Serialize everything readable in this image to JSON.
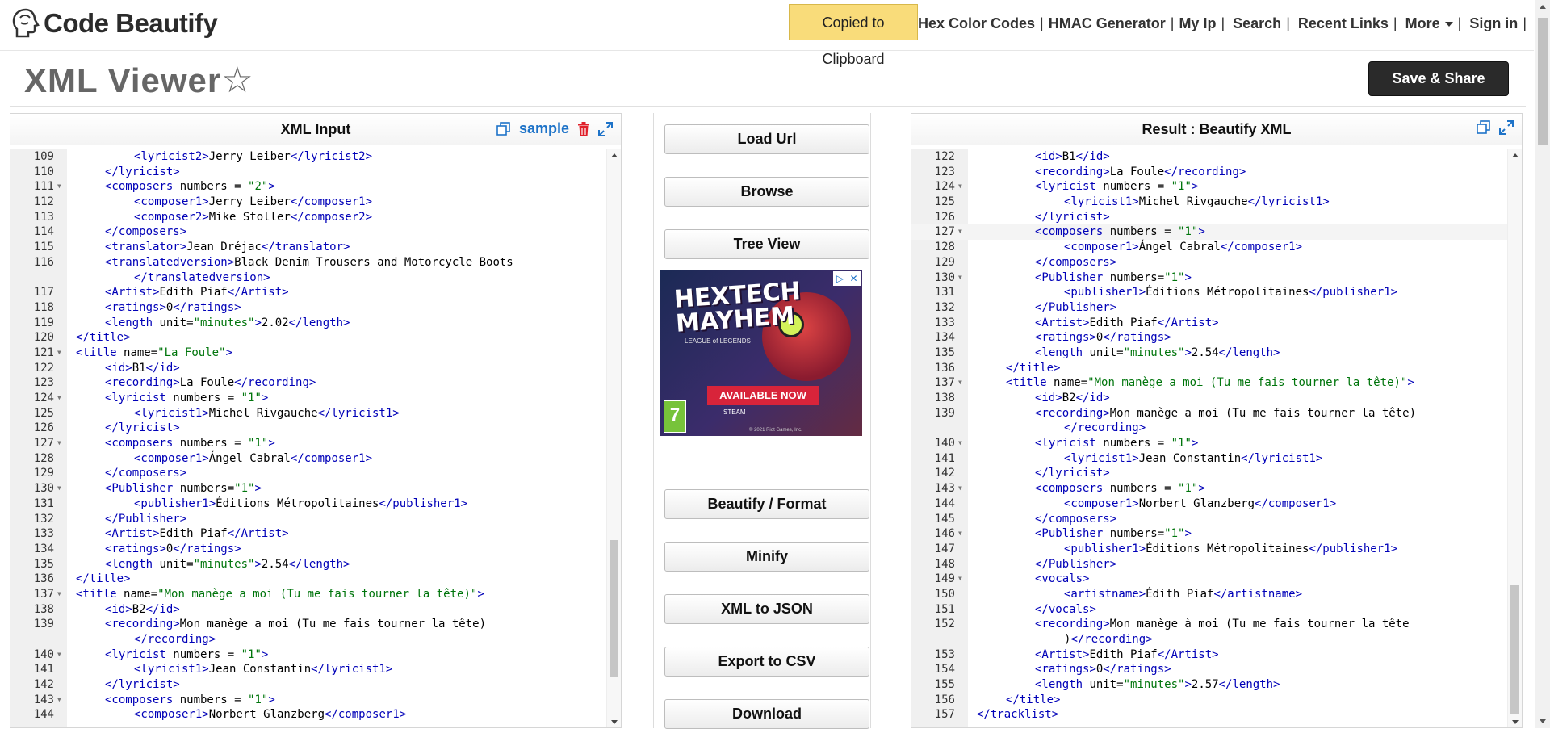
{
  "header": {
    "logo_text": "Code Beautify",
    "toast": "Copied to Clipboard",
    "nav": [
      "Hex Color Codes",
      "HMAC Generator",
      "My Ip",
      "Search",
      "Recent Links",
      "More",
      "Sign in"
    ],
    "separator": "|"
  },
  "page": {
    "title": "XML Viewer",
    "star": "☆",
    "save_share": "Save & Share"
  },
  "left_panel": {
    "title": "XML Input",
    "sample_link": "sample"
  },
  "right_panel": {
    "title": "Result : Beautify XML"
  },
  "middle_buttons": {
    "load_url": "Load Url",
    "browse": "Browse",
    "tree_view": "Tree View",
    "beautify": "Beautify / Format",
    "minify": "Minify",
    "xml_to_json": "XML to JSON",
    "export_csv": "Export to CSV",
    "download": "Download"
  },
  "ad": {
    "headline": "HEXTECH MAYHEM",
    "subline": "LEAGUE of LEGENDS",
    "cta": "AVAILABLE NOW",
    "rating": "7",
    "platforms": "STEAM",
    "copyright": "© 2021 Riot Games, Inc."
  },
  "left_lines": [
    {
      "n": "109",
      "f": false,
      "i": 2,
      "t": [
        [
          "tag",
          "<lyricist2>"
        ],
        [
          "txt",
          "Jerry Leiber"
        ],
        [
          "tag",
          "</lyricist2>"
        ]
      ]
    },
    {
      "n": "110",
      "f": false,
      "i": 1,
      "t": [
        [
          "tag",
          "</lyricist>"
        ]
      ]
    },
    {
      "n": "111",
      "f": true,
      "i": 1,
      "t": [
        [
          "tag",
          "<composers "
        ],
        [
          "txt",
          "numbers = "
        ],
        [
          "val",
          "\"2\""
        ],
        [
          "tag",
          ">"
        ]
      ]
    },
    {
      "n": "112",
      "f": false,
      "i": 2,
      "t": [
        [
          "tag",
          "<composer1>"
        ],
        [
          "txt",
          "Jerry Leiber"
        ],
        [
          "tag",
          "</composer1>"
        ]
      ]
    },
    {
      "n": "113",
      "f": false,
      "i": 2,
      "t": [
        [
          "tag",
          "<composer2>"
        ],
        [
          "txt",
          "Mike Stoller"
        ],
        [
          "tag",
          "</composer2>"
        ]
      ]
    },
    {
      "n": "114",
      "f": false,
      "i": 1,
      "t": [
        [
          "tag",
          "</composers>"
        ]
      ]
    },
    {
      "n": "115",
      "f": false,
      "i": 1,
      "t": [
        [
          "tag",
          "<translator>"
        ],
        [
          "txt",
          "Jean Dréjac"
        ],
        [
          "tag",
          "</translator>"
        ]
      ]
    },
    {
      "n": "116",
      "f": false,
      "i": 1,
      "t": [
        [
          "tag",
          "<translatedversion>"
        ],
        [
          "txt",
          "Black Denim Trousers and Motorcycle Boots"
        ]
      ]
    },
    {
      "n": "",
      "f": false,
      "i": 2,
      "t": [
        [
          "tag",
          "</translatedversion>"
        ]
      ]
    },
    {
      "n": "117",
      "f": false,
      "i": 1,
      "t": [
        [
          "tag",
          "<Artist>"
        ],
        [
          "txt",
          "Edith Piaf"
        ],
        [
          "tag",
          "</Artist>"
        ]
      ]
    },
    {
      "n": "118",
      "f": false,
      "i": 1,
      "t": [
        [
          "tag",
          "<ratings>"
        ],
        [
          "txt",
          "0"
        ],
        [
          "tag",
          "</ratings>"
        ]
      ]
    },
    {
      "n": "119",
      "f": false,
      "i": 1,
      "t": [
        [
          "tag",
          "<length "
        ],
        [
          "txt",
          "unit="
        ],
        [
          "val",
          "\"minutes\""
        ],
        [
          "tag",
          ">"
        ],
        [
          "txt",
          "2.02"
        ],
        [
          "tag",
          "</length>"
        ]
      ]
    },
    {
      "n": "120",
      "f": false,
      "i": 0,
      "t": [
        [
          "tag",
          "</title>"
        ]
      ]
    },
    {
      "n": "121",
      "f": true,
      "i": 0,
      "t": [
        [
          "tag",
          "<title "
        ],
        [
          "txt",
          "name="
        ],
        [
          "val",
          "\"La Foule\""
        ],
        [
          "tag",
          ">"
        ]
      ]
    },
    {
      "n": "122",
      "f": false,
      "i": 1,
      "t": [
        [
          "tag",
          "<id>"
        ],
        [
          "txt",
          "B1"
        ],
        [
          "tag",
          "</id>"
        ]
      ]
    },
    {
      "n": "123",
      "f": false,
      "i": 1,
      "t": [
        [
          "tag",
          "<recording>"
        ],
        [
          "txt",
          "La Foule"
        ],
        [
          "tag",
          "</recording>"
        ]
      ]
    },
    {
      "n": "124",
      "f": true,
      "i": 1,
      "t": [
        [
          "tag",
          "<lyricist "
        ],
        [
          "txt",
          "numbers = "
        ],
        [
          "val",
          "\"1\""
        ],
        [
          "tag",
          ">"
        ]
      ]
    },
    {
      "n": "125",
      "f": false,
      "i": 2,
      "t": [
        [
          "tag",
          "<lyricist1>"
        ],
        [
          "txt",
          "Michel Rivgauche"
        ],
        [
          "tag",
          "</lyricist1>"
        ]
      ]
    },
    {
      "n": "126",
      "f": false,
      "i": 1,
      "t": [
        [
          "tag",
          "</lyricist>"
        ]
      ]
    },
    {
      "n": "127",
      "f": true,
      "i": 1,
      "t": [
        [
          "tag",
          "<composers "
        ],
        [
          "txt",
          "numbers = "
        ],
        [
          "val",
          "\"1\""
        ],
        [
          "tag",
          ">"
        ]
      ]
    },
    {
      "n": "128",
      "f": false,
      "i": 2,
      "t": [
        [
          "tag",
          "<composer1>"
        ],
        [
          "txt",
          "Ángel Cabral"
        ],
        [
          "tag",
          "</composer1>"
        ]
      ]
    },
    {
      "n": "129",
      "f": false,
      "i": 1,
      "t": [
        [
          "tag",
          "</composers>"
        ]
      ]
    },
    {
      "n": "130",
      "f": true,
      "i": 1,
      "t": [
        [
          "tag",
          "<Publisher "
        ],
        [
          "txt",
          "numbers="
        ],
        [
          "val",
          "\"1\""
        ],
        [
          "tag",
          ">"
        ]
      ]
    },
    {
      "n": "131",
      "f": false,
      "i": 2,
      "t": [
        [
          "tag",
          "<publisher1>"
        ],
        [
          "txt",
          "Éditions Métropolitaines"
        ],
        [
          "tag",
          "</publisher1>"
        ]
      ]
    },
    {
      "n": "132",
      "f": false,
      "i": 1,
      "t": [
        [
          "tag",
          "</Publisher>"
        ]
      ]
    },
    {
      "n": "133",
      "f": false,
      "i": 1,
      "t": [
        [
          "tag",
          "<Artist>"
        ],
        [
          "txt",
          "Edith Piaf"
        ],
        [
          "tag",
          "</Artist>"
        ]
      ]
    },
    {
      "n": "134",
      "f": false,
      "i": 1,
      "t": [
        [
          "tag",
          "<ratings>"
        ],
        [
          "txt",
          "0"
        ],
        [
          "tag",
          "</ratings>"
        ]
      ]
    },
    {
      "n": "135",
      "f": false,
      "i": 1,
      "t": [
        [
          "tag",
          "<length "
        ],
        [
          "txt",
          "unit="
        ],
        [
          "val",
          "\"minutes\""
        ],
        [
          "tag",
          ">"
        ],
        [
          "txt",
          "2.54"
        ],
        [
          "tag",
          "</length>"
        ]
      ]
    },
    {
      "n": "136",
      "f": false,
      "i": 0,
      "t": [
        [
          "tag",
          "</title>"
        ]
      ]
    },
    {
      "n": "137",
      "f": true,
      "i": 0,
      "t": [
        [
          "tag",
          "<title "
        ],
        [
          "txt",
          "name="
        ],
        [
          "val",
          "\"Mon manège a moi (Tu me fais tourner la tête)\""
        ],
        [
          "tag",
          ">"
        ]
      ]
    },
    {
      "n": "138",
      "f": false,
      "i": 1,
      "t": [
        [
          "tag",
          "<id>"
        ],
        [
          "txt",
          "B2"
        ],
        [
          "tag",
          "</id>"
        ]
      ]
    },
    {
      "n": "139",
      "f": false,
      "i": 1,
      "t": [
        [
          "tag",
          "<recording>"
        ],
        [
          "txt",
          "Mon manège a moi (Tu me fais tourner la tête)"
        ]
      ]
    },
    {
      "n": "",
      "f": false,
      "i": 2,
      "t": [
        [
          "tag",
          "</recording>"
        ]
      ]
    },
    {
      "n": "140",
      "f": true,
      "i": 1,
      "t": [
        [
          "tag",
          "<lyricist "
        ],
        [
          "txt",
          "numbers = "
        ],
        [
          "val",
          "\"1\""
        ],
        [
          "tag",
          ">"
        ]
      ]
    },
    {
      "n": "141",
      "f": false,
      "i": 2,
      "t": [
        [
          "tag",
          "<lyricist1>"
        ],
        [
          "txt",
          "Jean Constantin"
        ],
        [
          "tag",
          "</lyricist1>"
        ]
      ]
    },
    {
      "n": "142",
      "f": false,
      "i": 1,
      "t": [
        [
          "tag",
          "</lyricist>"
        ]
      ]
    },
    {
      "n": "143",
      "f": true,
      "i": 1,
      "t": [
        [
          "tag",
          "<composers "
        ],
        [
          "txt",
          "numbers = "
        ],
        [
          "val",
          "\"1\""
        ],
        [
          "tag",
          ">"
        ]
      ]
    },
    {
      "n": "144",
      "f": false,
      "i": 2,
      "t": [
        [
          "tag",
          "<composer1>"
        ],
        [
          "txt",
          "Norbert Glanzberg"
        ],
        [
          "tag",
          "</composer1>"
        ]
      ]
    }
  ],
  "right_lines": [
    {
      "n": "122",
      "f": false,
      "i": 2,
      "t": [
        [
          "tag",
          "<id>"
        ],
        [
          "txt",
          "B1"
        ],
        [
          "tag",
          "</id>"
        ]
      ]
    },
    {
      "n": "123",
      "f": false,
      "i": 2,
      "t": [
        [
          "tag",
          "<recording>"
        ],
        [
          "txt",
          "La Foule"
        ],
        [
          "tag",
          "</recording>"
        ]
      ]
    },
    {
      "n": "124",
      "f": true,
      "i": 2,
      "t": [
        [
          "tag",
          "<lyricist "
        ],
        [
          "txt",
          "numbers = "
        ],
        [
          "val",
          "\"1\""
        ],
        [
          "tag",
          ">"
        ]
      ]
    },
    {
      "n": "125",
      "f": false,
      "i": 3,
      "t": [
        [
          "tag",
          "<lyricist1>"
        ],
        [
          "txt",
          "Michel Rivgauche"
        ],
        [
          "tag",
          "</lyricist1>"
        ]
      ]
    },
    {
      "n": "126",
      "f": false,
      "i": 2,
      "t": [
        [
          "tag",
          "</lyricist>"
        ]
      ]
    },
    {
      "n": "127",
      "f": true,
      "i": 2,
      "a": true,
      "t": [
        [
          "tag",
          "<composers "
        ],
        [
          "txt",
          "numbers = "
        ],
        [
          "val",
          "\"1\""
        ],
        [
          "tag",
          ">"
        ]
      ]
    },
    {
      "n": "128",
      "f": false,
      "i": 3,
      "t": [
        [
          "tag",
          "<composer1>"
        ],
        [
          "txt",
          "Ángel Cabral"
        ],
        [
          "tag",
          "</composer1>"
        ]
      ]
    },
    {
      "n": "129",
      "f": false,
      "i": 2,
      "t": [
        [
          "tag",
          "</composers>"
        ]
      ]
    },
    {
      "n": "130",
      "f": true,
      "i": 2,
      "t": [
        [
          "tag",
          "<Publisher "
        ],
        [
          "txt",
          "numbers="
        ],
        [
          "val",
          "\"1\""
        ],
        [
          "tag",
          ">"
        ]
      ]
    },
    {
      "n": "131",
      "f": false,
      "i": 3,
      "t": [
        [
          "tag",
          "<publisher1>"
        ],
        [
          "txt",
          "Éditions Métropolitaines"
        ],
        [
          "tag",
          "</publisher1>"
        ]
      ]
    },
    {
      "n": "132",
      "f": false,
      "i": 2,
      "t": [
        [
          "tag",
          "</Publisher>"
        ]
      ]
    },
    {
      "n": "133",
      "f": false,
      "i": 2,
      "t": [
        [
          "tag",
          "<Artist>"
        ],
        [
          "txt",
          "Edith Piaf"
        ],
        [
          "tag",
          "</Artist>"
        ]
      ]
    },
    {
      "n": "134",
      "f": false,
      "i": 2,
      "t": [
        [
          "tag",
          "<ratings>"
        ],
        [
          "txt",
          "0"
        ],
        [
          "tag",
          "</ratings>"
        ]
      ]
    },
    {
      "n": "135",
      "f": false,
      "i": 2,
      "t": [
        [
          "tag",
          "<length "
        ],
        [
          "txt",
          "unit="
        ],
        [
          "val",
          "\"minutes\""
        ],
        [
          "tag",
          ">"
        ],
        [
          "txt",
          "2.54"
        ],
        [
          "tag",
          "</length>"
        ]
      ]
    },
    {
      "n": "136",
      "f": false,
      "i": 1,
      "t": [
        [
          "tag",
          "</title>"
        ]
      ]
    },
    {
      "n": "137",
      "f": true,
      "i": 1,
      "t": [
        [
          "tag",
          "<title "
        ],
        [
          "txt",
          "name="
        ],
        [
          "val",
          "\"Mon manège a moi (Tu me fais tourner la tête)\""
        ],
        [
          "tag",
          ">"
        ]
      ]
    },
    {
      "n": "138",
      "f": false,
      "i": 2,
      "t": [
        [
          "tag",
          "<id>"
        ],
        [
          "txt",
          "B2"
        ],
        [
          "tag",
          "</id>"
        ]
      ]
    },
    {
      "n": "139",
      "f": false,
      "i": 2,
      "t": [
        [
          "tag",
          "<recording>"
        ],
        [
          "txt",
          "Mon manège a moi (Tu me fais tourner la tête)"
        ]
      ]
    },
    {
      "n": "",
      "f": false,
      "i": 3,
      "t": [
        [
          "tag",
          "</recording>"
        ]
      ]
    },
    {
      "n": "140",
      "f": true,
      "i": 2,
      "t": [
        [
          "tag",
          "<lyricist "
        ],
        [
          "txt",
          "numbers = "
        ],
        [
          "val",
          "\"1\""
        ],
        [
          "tag",
          ">"
        ]
      ]
    },
    {
      "n": "141",
      "f": false,
      "i": 3,
      "t": [
        [
          "tag",
          "<lyricist1>"
        ],
        [
          "txt",
          "Jean Constantin"
        ],
        [
          "tag",
          "</lyricist1>"
        ]
      ]
    },
    {
      "n": "142",
      "f": false,
      "i": 2,
      "t": [
        [
          "tag",
          "</lyricist>"
        ]
      ]
    },
    {
      "n": "143",
      "f": true,
      "i": 2,
      "t": [
        [
          "tag",
          "<composers "
        ],
        [
          "txt",
          "numbers = "
        ],
        [
          "val",
          "\"1\""
        ],
        [
          "tag",
          ">"
        ]
      ]
    },
    {
      "n": "144",
      "f": false,
      "i": 3,
      "t": [
        [
          "tag",
          "<composer1>"
        ],
        [
          "txt",
          "Norbert Glanzberg"
        ],
        [
          "tag",
          "</composer1>"
        ]
      ]
    },
    {
      "n": "145",
      "f": false,
      "i": 2,
      "t": [
        [
          "tag",
          "</composers>"
        ]
      ]
    },
    {
      "n": "146",
      "f": true,
      "i": 2,
      "t": [
        [
          "tag",
          "<Publisher "
        ],
        [
          "txt",
          "numbers="
        ],
        [
          "val",
          "\"1\""
        ],
        [
          "tag",
          ">"
        ]
      ]
    },
    {
      "n": "147",
      "f": false,
      "i": 3,
      "t": [
        [
          "tag",
          "<publisher1>"
        ],
        [
          "txt",
          "Éditions Métropolitaines"
        ],
        [
          "tag",
          "</publisher1>"
        ]
      ]
    },
    {
      "n": "148",
      "f": false,
      "i": 2,
      "t": [
        [
          "tag",
          "</Publisher>"
        ]
      ]
    },
    {
      "n": "149",
      "f": true,
      "i": 2,
      "t": [
        [
          "tag",
          "<vocals>"
        ]
      ]
    },
    {
      "n": "150",
      "f": false,
      "i": 3,
      "t": [
        [
          "tag",
          "<artistname>"
        ],
        [
          "txt",
          "Édith Piaf"
        ],
        [
          "tag",
          "</artistname>"
        ]
      ]
    },
    {
      "n": "151",
      "f": false,
      "i": 2,
      "t": [
        [
          "tag",
          "</vocals>"
        ]
      ]
    },
    {
      "n": "152",
      "f": false,
      "i": 2,
      "t": [
        [
          "tag",
          "<recording>"
        ],
        [
          "txt",
          "Mon manège à moi (Tu me fais tourner la tête"
        ]
      ]
    },
    {
      "n": "",
      "f": false,
      "i": 3,
      "t": [
        [
          "txt",
          ")"
        ],
        [
          "tag",
          "</recording>"
        ]
      ]
    },
    {
      "n": "153",
      "f": false,
      "i": 2,
      "t": [
        [
          "tag",
          "<Artist>"
        ],
        [
          "txt",
          "Edith Piaf"
        ],
        [
          "tag",
          "</Artist>"
        ]
      ]
    },
    {
      "n": "154",
      "f": false,
      "i": 2,
      "t": [
        [
          "tag",
          "<ratings>"
        ],
        [
          "txt",
          "0"
        ],
        [
          "tag",
          "</ratings>"
        ]
      ]
    },
    {
      "n": "155",
      "f": false,
      "i": 2,
      "t": [
        [
          "tag",
          "<length "
        ],
        [
          "txt",
          "unit="
        ],
        [
          "val",
          "\"minutes\""
        ],
        [
          "tag",
          ">"
        ],
        [
          "txt",
          "2.57"
        ],
        [
          "tag",
          "</length>"
        ]
      ]
    },
    {
      "n": "156",
      "f": false,
      "i": 1,
      "t": [
        [
          "tag",
          "</title>"
        ]
      ]
    },
    {
      "n": "157",
      "f": false,
      "i": 0,
      "t": [
        [
          "tag",
          "</tracklist>"
        ]
      ]
    }
  ],
  "colors": {
    "tag": "#0000b8",
    "value": "#00750c",
    "toast": "#f9dc7a",
    "link": "#1e73c8"
  }
}
